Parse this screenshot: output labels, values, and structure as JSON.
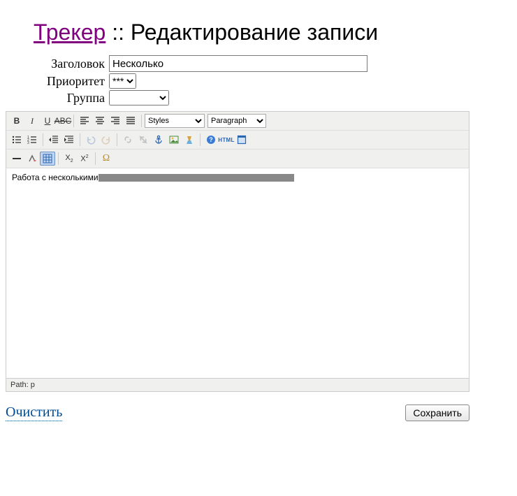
{
  "header": {
    "tracker_link": "Трекер",
    "separator": " :: ",
    "title": "Редактирование записи"
  },
  "form": {
    "title_label": "Заголовок",
    "title_value": "Несколько ",
    "priority_label": "Приоритет",
    "priority_value": "***",
    "group_label": "Группа",
    "group_value": ""
  },
  "editor": {
    "styles_label": "Styles",
    "paragraph_label": "Paragraph",
    "body_text": "Работа с несколькими",
    "path_label": "Path: p"
  },
  "bottom": {
    "clear": "Очистить",
    "save": "Сохранить"
  }
}
